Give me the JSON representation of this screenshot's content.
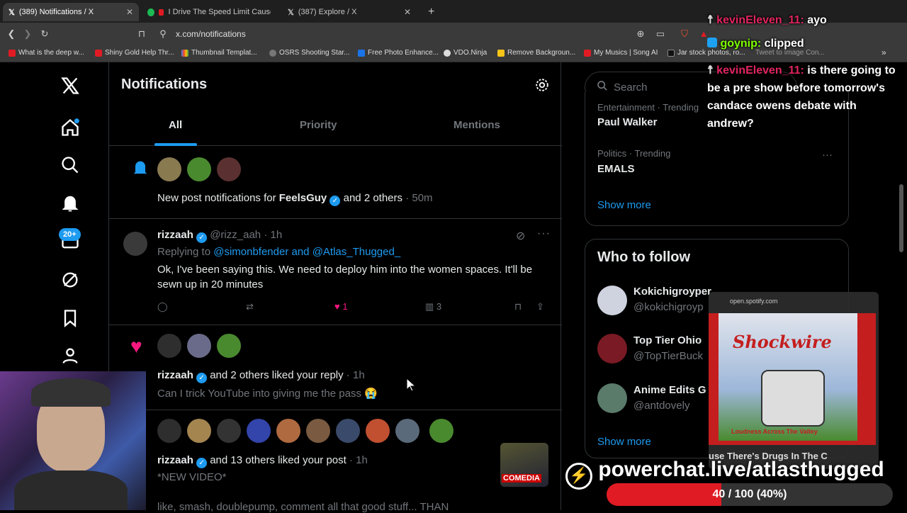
{
  "browser": {
    "tabs": [
      {
        "title": "(389) Notifications / X",
        "active": true
      },
      {
        "title": "I Drive The Speed Limit Cause Th",
        "active": false
      },
      {
        "title": "(387) Explore / X",
        "active": false
      }
    ],
    "url": "x.com/notifications",
    "bookmarks": [
      "What is the deep w...",
      "Shiny Gold Help Thr...",
      "Thumbnail Templat...",
      "OSRS Shooting Star...",
      "Free Photo Enhance...",
      "VDO.Ninja",
      "Remove Backgroun...",
      "My Musics | Song AI",
      "Jar stock photos, ro...",
      "Tweet to Image Con..."
    ]
  },
  "nav": {
    "badge": "20+"
  },
  "header": {
    "title": "Notifications",
    "tabs": [
      "All",
      "Priority",
      "Mentions"
    ]
  },
  "notifications": {
    "n1": {
      "prefix": "New post notifications for ",
      "user": "FeelsGuy",
      "suffix": " and 2 others",
      "time": "· 50m"
    },
    "n2": {
      "name": "rizzaah",
      "handle": "@rizz_aah",
      "time": "· 1h",
      "replying_label": "Replying to ",
      "replying_to": "@simonbfender and @Atlas_Thugged_",
      "text": "Ok, I've been saying this. We need to deploy him into the women spaces. It'll be sewn up in 20 minutes",
      "likes": "1",
      "views": "3"
    },
    "n3": {
      "name": "rizzaah",
      "action": " and 2 others liked your reply",
      "time": " · 1h",
      "text": "Can I trick YouTube into giving me the pass 😭"
    },
    "n4": {
      "name": "rizzaah",
      "action": " and 13 others liked your post",
      "time": " · 1h",
      "text": "*NEW VIDEO*",
      "text2": "like, smash, doublepump, comment all that good stuff... THAN",
      "thumb_label": "COMEDIA"
    }
  },
  "sidebar": {
    "search_placeholder": "Search",
    "trending": [
      {
        "category": "Entertainment · Trending",
        "topic": "Paul Walker"
      },
      {
        "category": "Politics · Trending",
        "topic": "EMALS"
      }
    ],
    "show_more": "Show more",
    "who_to_follow": {
      "title": "Who to follow",
      "people": [
        {
          "name": "Kokichigroyper",
          "handle": "@kokichigroyp"
        },
        {
          "name": "Top Tier Ohio",
          "handle": "@TopTierBuck"
        },
        {
          "name": "Anime Edits G",
          "handle": "@antdovely"
        }
      ],
      "show_more": "Show more"
    }
  },
  "overlay": {
    "chat": [
      {
        "name": "kevinEleven_11:",
        "msg": " ayo"
      },
      {
        "name": "goynip:",
        "msg": " clipped"
      },
      {
        "name": "kevinEleven_11:",
        "msg": " is there going to be a pre show before tomorrow's candace owens debate with andrew?"
      }
    ],
    "spotify": {
      "source": "open.spotify.com",
      "art_title": "Shockwire",
      "art_sub": "Loudness Across The Valley",
      "track": "use There's Drugs In The C"
    },
    "powerchat": "powerchat.live/atlasthugged",
    "goal": {
      "label": "40 / 100 (40%)",
      "fraction": 0.4
    }
  },
  "colors": {
    "accent": "#1d9bf0",
    "like": "#f91880",
    "goal": "#e01b24"
  }
}
